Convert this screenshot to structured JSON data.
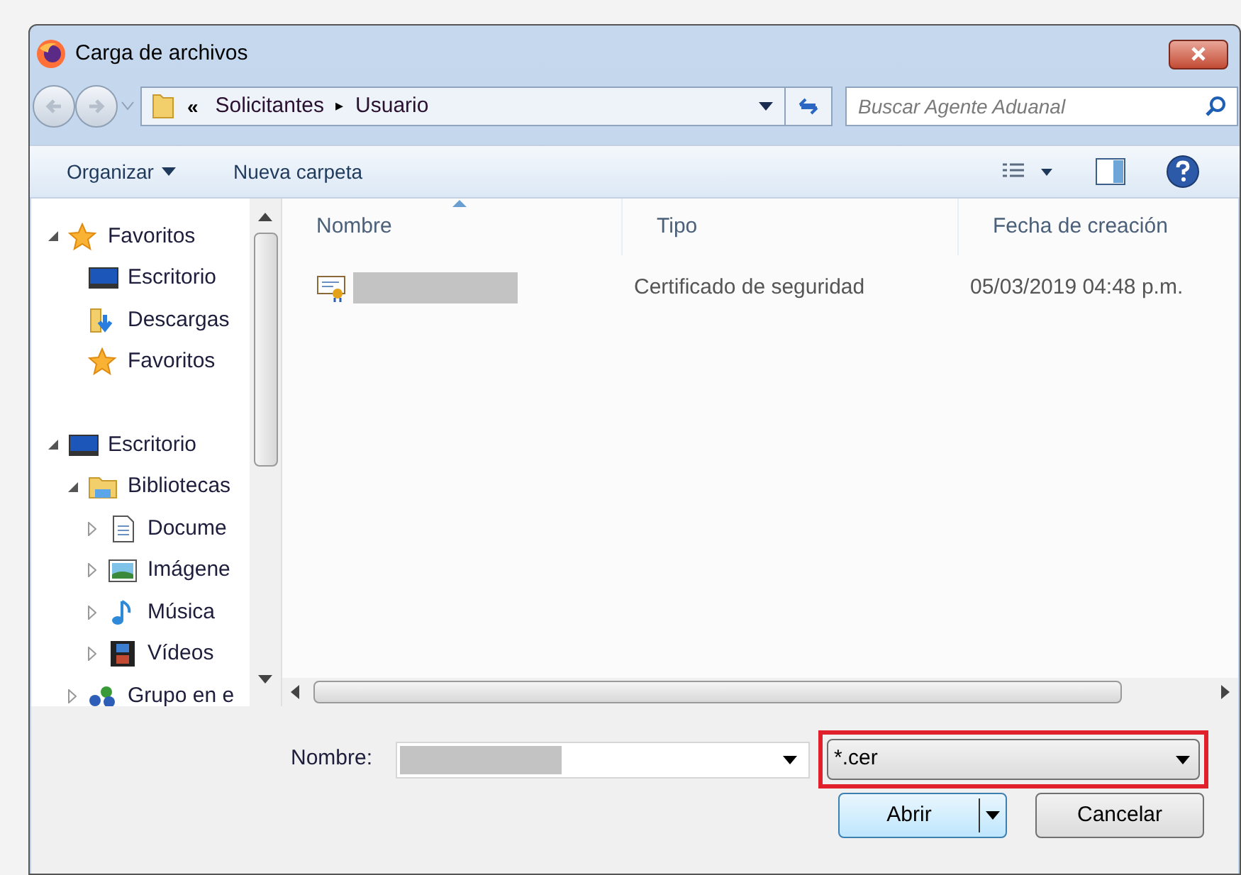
{
  "window": {
    "title": "Carga de archivos"
  },
  "address": {
    "overflow": "«",
    "crumbs": [
      "Solicitantes",
      "Usuario"
    ],
    "separator": "▸"
  },
  "search": {
    "placeholder": "Buscar Agente Aduanal"
  },
  "toolbar": {
    "organize": "Organizar",
    "new_folder": "Nueva carpeta"
  },
  "tree": [
    {
      "label": "Favoritos",
      "kind": "star",
      "expanded": true,
      "children": [
        {
          "label": "Escritorio",
          "kind": "desktop"
        },
        {
          "label": "Descargas",
          "kind": "downloads"
        },
        {
          "label": "Favoritos",
          "kind": "star"
        }
      ]
    },
    {
      "label": "Escritorio",
      "kind": "desktop",
      "expanded": true,
      "children": [
        {
          "label": "Bibliotecas",
          "kind": "library",
          "expanded": true,
          "children": [
            {
              "label": "Docume",
              "kind": "document",
              "expanded": false
            },
            {
              "label": "Imágene",
              "kind": "pictures",
              "expanded": false
            },
            {
              "label": "Música",
              "kind": "music",
              "expanded": false
            },
            {
              "label": "Vídeos",
              "kind": "video",
              "expanded": false
            }
          ]
        },
        {
          "label": "Grupo en e",
          "kind": "network",
          "expanded": false
        }
      ]
    }
  ],
  "table": {
    "columns": [
      {
        "label": "Nombre",
        "sorted": true
      },
      {
        "label": "Tipo",
        "sorted": false
      },
      {
        "label": "Fecha de creación",
        "sorted": false
      }
    ],
    "rows": [
      {
        "name_hidden": true,
        "type": "Certificado de seguridad",
        "date": "05/03/2019 04:48 p.m."
      }
    ]
  },
  "file_name": {
    "label": "Nombre:",
    "value_hidden": true
  },
  "filter": {
    "value": "*.cer",
    "highlighted": true
  },
  "buttons": {
    "open": "Abrir",
    "cancel": "Cancelar"
  }
}
